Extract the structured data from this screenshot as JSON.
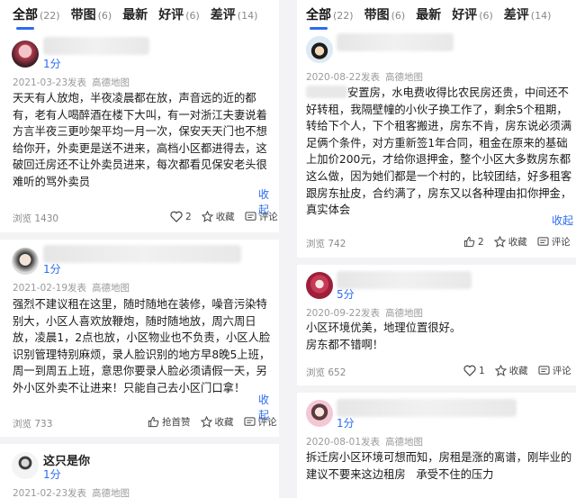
{
  "tabs": [
    {
      "label": "全部",
      "count": "(22)"
    },
    {
      "label": "带图",
      "count": "(6)"
    },
    {
      "label": "最新",
      "count": ""
    },
    {
      "label": "好评",
      "count": "(6)"
    },
    {
      "label": "差评",
      "count": "(14)"
    }
  ],
  "left": {
    "review1": {
      "score": "1分",
      "date": "2021-03-23发表",
      "source": "高德地图",
      "text": "天天有人放炮，半夜凌晨都在放，声音远的近的都有，老有人喝醉酒在楼下大叫，有一对浙江夫妻说着方言半夜三更吵架平均一月一次，保安天天门也不想给你开，外卖更是送不进来，高档小区都进得去，这破回迁房还不让外卖员进来，每次都看见保安老头很难听的骂外卖员",
      "collapse": "收起",
      "views": "浏览 1430",
      "like": "2",
      "fav": "收藏",
      "comment": "评论"
    },
    "review2": {
      "score": "1分",
      "date": "2021-02-19发表",
      "source": "高德地图",
      "text": "强烈不建议租在这里，随时随地在装修，噪音污染特别大，小区人喜欢放鞭炮，随时随地放，周六周日放，凌晨1，2点也放，小区物业也不负责，小区人脸识别管理特别麻烦，录人脸识别的地方早8晚5上班，周一到周五上班，意思你要录人脸必须请假一天，另外小区外卖不让进来！只能自己去小区门口拿！",
      "collapse": "收起",
      "views": "浏览 733",
      "like": "抢首赞",
      "fav": "收藏",
      "comment": "评论"
    },
    "review3": {
      "name": "这只是你",
      "score": "1分",
      "date": "2021-02-23发表",
      "source": "高德地图"
    }
  },
  "right": {
    "review1": {
      "date": "2020-08-22发表",
      "source": "高德地图",
      "text": "安置房，水电费收得比农民房还贵，中间还不好转租，我隔壁幢的小伙子换工作了，剩余5个租期，转给下个人，下个租客搬进，房东不肯，房东说必须满足俩个条件，对方重新签1年合同，租金在原来的基础上加价200元，才给你退押金，整个小区大多数房东都这么做，因为她们都是一个村的，比较团结，好多租客跟房东扯皮，合约满了，房东又以各种理由扣你押金，真实体会",
      "collapse": "收起",
      "views": "浏览 742",
      "like": "2",
      "fav": "收藏",
      "comment": "评论"
    },
    "review2": {
      "score": "5分",
      "date": "2020-09-22发表",
      "source": "高德地图",
      "text": "小区环境优美，地理位置很好。房东都不错啊！",
      "views": "浏览 652",
      "like": "1",
      "fav": "收藏",
      "comment": "评论"
    },
    "review3": {
      "score": "1分",
      "date": "2020-08-01发表",
      "source": "高德地图",
      "text": "拆迁房小区环境可想而知，房租是涨的离谱，刚毕业的建议不要来这边租房   承受不住的压力"
    }
  },
  "colors": {
    "accent": "#2a6bf2",
    "text": "#1a1a1a",
    "muted": "#9a9a9a",
    "divider": "#f3f3f5"
  }
}
